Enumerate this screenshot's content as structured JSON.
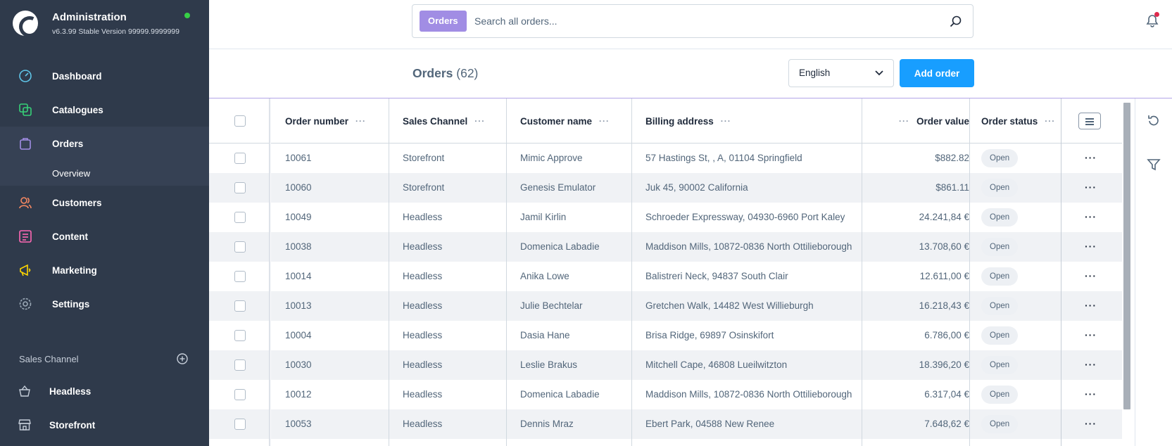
{
  "brand": {
    "title": "Administration",
    "version": "v6.3.99 Stable Version 99999.9999999",
    "status_color": "#37d046"
  },
  "sidebar": {
    "items": [
      {
        "label": "Dashboard",
        "icon": "gauge-icon",
        "color": "#5fc5e8"
      },
      {
        "label": "Catalogues",
        "icon": "catalogue-icon",
        "color": "#37d078"
      },
      {
        "label": "Orders",
        "icon": "shopping-bag-icon",
        "color": "#a18de4",
        "active": true
      },
      {
        "label": "Customers",
        "icon": "users-icon",
        "color": "#f88962"
      },
      {
        "label": "Content",
        "icon": "content-icon",
        "color": "#ff68b4"
      },
      {
        "label": "Marketing",
        "icon": "megaphone-icon",
        "color": "#ffd700"
      },
      {
        "label": "Settings",
        "icon": "gear-icon",
        "color": "#9aa8b5"
      }
    ],
    "sub_item": "Overview",
    "sales_channel_header": "Sales Channel",
    "sales_channels": [
      {
        "label": "Headless",
        "icon": "basket-icon"
      },
      {
        "label": "Storefront",
        "icon": "storefront-icon"
      }
    ]
  },
  "search": {
    "badge": "Orders",
    "placeholder": "Search all orders..."
  },
  "header": {
    "title": "Orders",
    "count": "(62)",
    "language": "English",
    "add_label": "Add order"
  },
  "columns": {
    "order_number": "Order number",
    "sales_channel": "Sales Channel",
    "customer_name": "Customer name",
    "billing_address": "Billing address",
    "order_value": "Order value",
    "order_status": "Order status"
  },
  "rows": [
    {
      "number": "10061",
      "channel": "Storefront",
      "customer": "Mimic Approve",
      "address": "57 Hastings St, , A, 01104 Springfield",
      "value": "$882.82",
      "status": "Open"
    },
    {
      "number": "10060",
      "channel": "Storefront",
      "customer": "Genesis Emulator",
      "address": "Juk 45, 90002 California",
      "value": "$861.11",
      "status": "Open"
    },
    {
      "number": "10049",
      "channel": "Headless",
      "customer": "Jamil Kirlin",
      "address": "Schroeder Expressway, 04930-6960 Port Kaley",
      "value": "24.241,84 €",
      "status": "Open"
    },
    {
      "number": "10038",
      "channel": "Headless",
      "customer": "Domenica Labadie",
      "address": "Maddison Mills, 10872-0836 North Ottilieborough",
      "value": "13.708,60 €",
      "status": "Open"
    },
    {
      "number": "10014",
      "channel": "Headless",
      "customer": "Anika Lowe",
      "address": "Balistreri Neck, 94837 South Clair",
      "value": "12.611,00 €",
      "status": "Open"
    },
    {
      "number": "10013",
      "channel": "Headless",
      "customer": "Julie Bechtelar",
      "address": "Gretchen Walk, 14482 West Willieburgh",
      "value": "16.218,43 €",
      "status": "Open"
    },
    {
      "number": "10004",
      "channel": "Headless",
      "customer": "Dasia Hane",
      "address": "Brisa Ridge, 69897 Osinskifort",
      "value": "6.786,00 €",
      "status": "Open"
    },
    {
      "number": "10030",
      "channel": "Headless",
      "customer": "Leslie Brakus",
      "address": "Mitchell Cape, 46808 Lueilwitzton",
      "value": "18.396,20 €",
      "status": "Open"
    },
    {
      "number": "10012",
      "channel": "Headless",
      "customer": "Domenica Labadie",
      "address": "Maddison Mills, 10872-0836 North Ottilieborough",
      "value": "6.317,04 €",
      "status": "Open"
    },
    {
      "number": "10053",
      "channel": "Headless",
      "customer": "Dennis Mraz",
      "address": "Ebert Park, 04588 New Renee",
      "value": "7.648,62 €",
      "status": "Open"
    }
  ],
  "colors": {
    "sidebar_bg": "#2f3a4b",
    "accent": "#189eff",
    "module_orders": "#a18de4",
    "notification": "#de294c"
  }
}
